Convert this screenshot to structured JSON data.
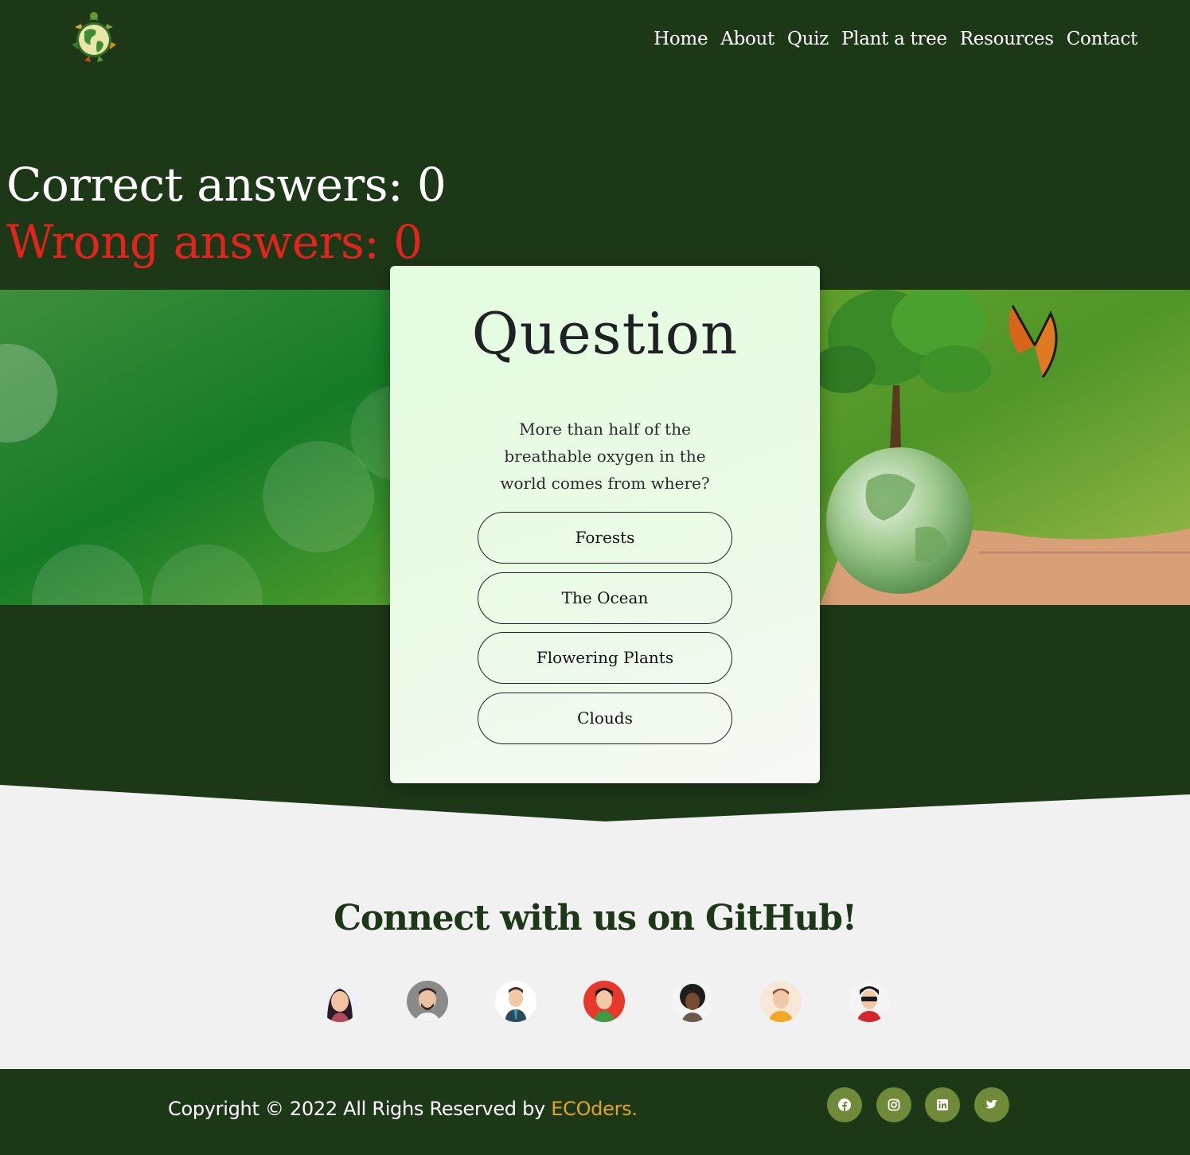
{
  "nav": {
    "items": [
      "Home",
      "About",
      "Quiz",
      "Plant a tree",
      "Resources",
      "Contact"
    ]
  },
  "score": {
    "correct_text": "Correct answers: 0",
    "wrong_text": "Wrong answers: 0"
  },
  "quiz": {
    "title": "Question",
    "question": "More than half of the breathable oxygen in the world comes from where?",
    "answers": [
      "Forests",
      "The Ocean",
      "Flowering Plants",
      "Clouds"
    ]
  },
  "github": {
    "heading": "Connect with us on GitHub!"
  },
  "footer": {
    "copyright": "Copyright © 2022 All Righs Reserved by ",
    "brand": "ECOders.",
    "socials": [
      "facebook-icon",
      "instagram-icon",
      "linkedin-icon",
      "twitter-icon"
    ]
  },
  "colors": {
    "background": "#1d3817",
    "wrong": "#e3231d",
    "brand": "#e3a520",
    "social": "#6f8a38",
    "light_section": "#f1f1f1"
  }
}
